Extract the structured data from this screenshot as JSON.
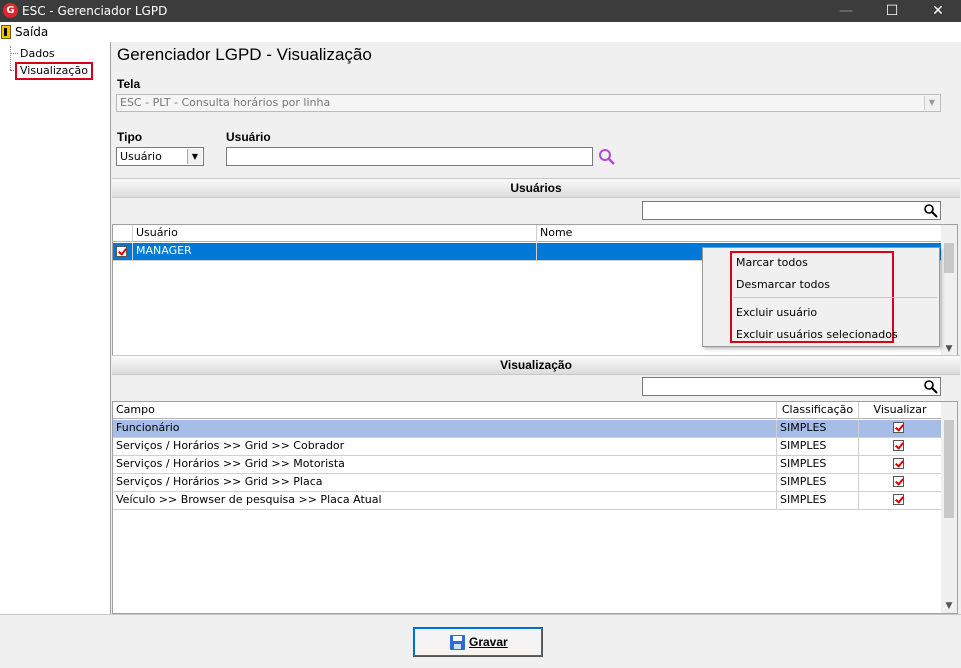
{
  "window": {
    "title": "ESC - Gerenciador LGPD",
    "app_icon": "G",
    "min": "—",
    "max": "☐",
    "close": "✕"
  },
  "menu": {
    "saida": "Saída"
  },
  "tree": {
    "items": [
      {
        "label": "Dados"
      },
      {
        "label": "Visualização"
      }
    ]
  },
  "page": {
    "title": "Gerenciador LGPD - Visualização"
  },
  "form": {
    "tela_label": "Tela",
    "tela_value": "ESC - PLT - Consulta horários por linha",
    "tipo_label": "Tipo",
    "tipo_value": "Usuário",
    "usuario_label": "Usuário",
    "usuario_value": ""
  },
  "usuarios": {
    "section_title": "Usuários",
    "filter_value": "",
    "columns": [
      "Usuário",
      "Nome"
    ],
    "rows": [
      {
        "checked": true,
        "usuario": "MANAGER",
        "nome": ""
      }
    ]
  },
  "context_menu": {
    "items": [
      "Marcar todos",
      "Desmarcar todos",
      "Excluir usuário",
      "Excluir usuários selecionados"
    ]
  },
  "visualizacao": {
    "section_title": "Visualização",
    "filter_value": "",
    "columns": [
      "Campo",
      "Classificação",
      "Visualizar"
    ],
    "rows": [
      {
        "campo": "Funcionário",
        "classificacao": "SIMPLES",
        "visualizar": true
      },
      {
        "campo": "Serviços / Horários >> Grid >> Cobrador",
        "classificacao": "SIMPLES",
        "visualizar": true
      },
      {
        "campo": "Serviços / Horários >> Grid >> Motorista",
        "classificacao": "SIMPLES",
        "visualizar": true
      },
      {
        "campo": "Serviços / Horários >> Grid >> Placa",
        "classificacao": "SIMPLES",
        "visualizar": true
      },
      {
        "campo": "Veículo >> Browser de pesquisa >> Placa Atual",
        "classificacao": "SIMPLES",
        "visualizar": true
      }
    ]
  },
  "footer": {
    "gravar_label": "Gravar"
  },
  "colors": {
    "selection_blue": "#0078d7",
    "selection_light": "#a6bde8",
    "highlight_red": "#d9001b",
    "search_purple": "#b04cd0"
  }
}
